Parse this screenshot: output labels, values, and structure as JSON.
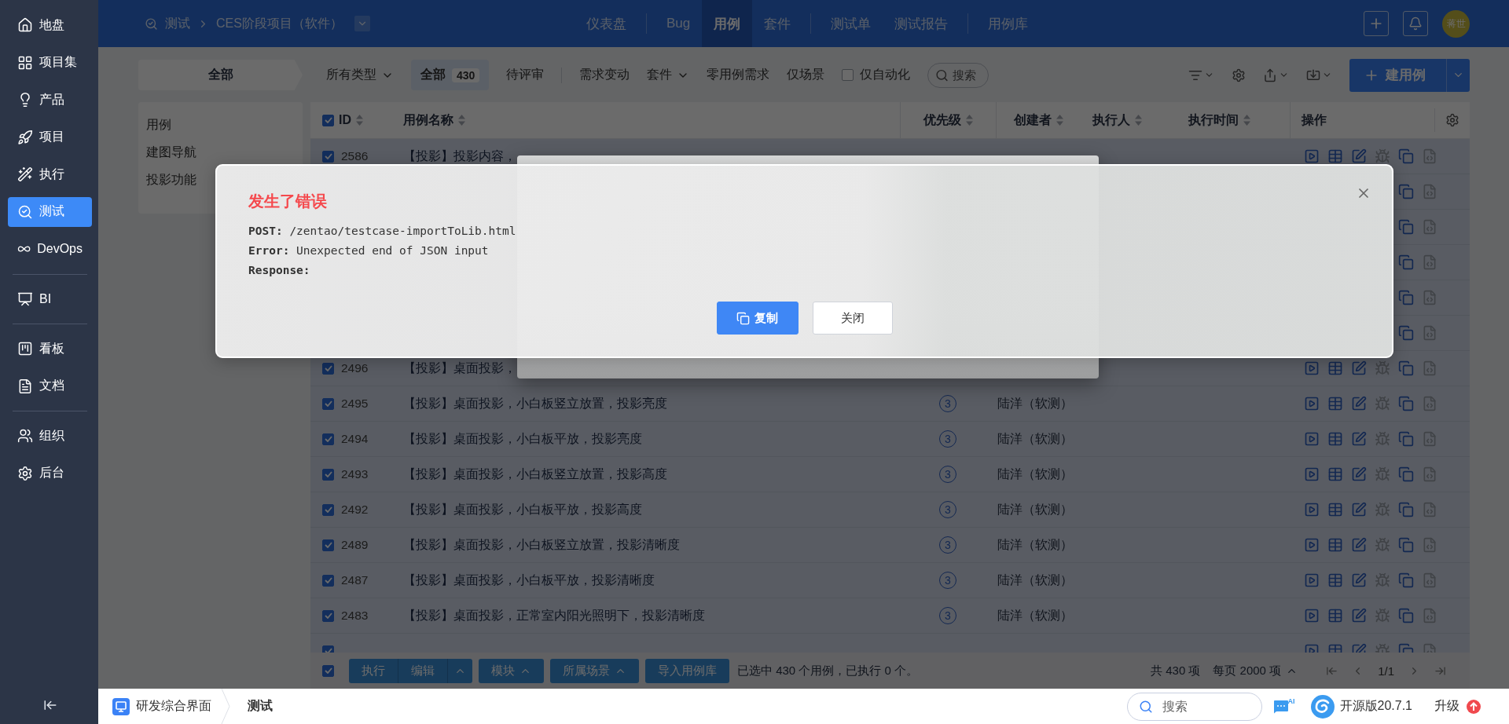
{
  "sidebar": {
    "groups": [
      {
        "items": [
          {
            "label": "地盘",
            "selected": false
          },
          {
            "label": "项目集",
            "selected": false
          },
          {
            "label": "产品",
            "selected": false
          },
          {
            "label": "项目",
            "selected": false
          },
          {
            "label": "执行",
            "selected": false
          },
          {
            "label": "测试",
            "selected": true
          },
          {
            "label": "DevOps",
            "selected": false
          }
        ]
      },
      {
        "items": [
          {
            "label": "BI",
            "selected": false
          }
        ]
      },
      {
        "items": [
          {
            "label": "看板",
            "selected": false
          },
          {
            "label": "文档",
            "selected": false
          }
        ]
      },
      {
        "items": [
          {
            "label": "组织",
            "selected": false
          },
          {
            "label": "后台",
            "selected": false
          }
        ]
      }
    ]
  },
  "topbar": {
    "breadcrumb": [
      "测试",
      "CES阶段项目（软件）"
    ],
    "nav_groups": [
      {
        "items": [
          {
            "label": "仪表盘",
            "selected": false
          }
        ]
      },
      {
        "items": [
          {
            "label": "Bug",
            "selected": false
          },
          {
            "label": "用例",
            "selected": true
          },
          {
            "label": "套件",
            "selected": false
          }
        ]
      },
      {
        "items": [
          {
            "label": "测试单",
            "selected": false
          },
          {
            "label": "测试报告",
            "selected": false
          }
        ]
      },
      {
        "items": [
          {
            "label": "用例库",
            "selected": false
          }
        ]
      }
    ],
    "avatar": "蒋世"
  },
  "toolbar": {
    "module_header": "全部",
    "type_filter": "所有类型",
    "tabs": [
      {
        "label": "全部",
        "count": "430",
        "selected": true
      },
      {
        "label": "待评审",
        "selected": false
      }
    ],
    "filters": [
      {
        "label": "需求变动",
        "kind": "link"
      },
      {
        "label": "套件",
        "kind": "dropdown"
      },
      {
        "label": "零用例需求",
        "kind": "link"
      },
      {
        "label": "仅场景",
        "kind": "link"
      },
      {
        "label": "仅自动化",
        "kind": "checkbox",
        "checked": false
      }
    ],
    "search_placeholder": "搜索",
    "create_button": "建用例"
  },
  "modules": [
    "用例",
    "建图导航",
    "投影功能"
  ],
  "table": {
    "header_checked": true,
    "columns": [
      "ID",
      "用例名称",
      "优先级",
      "创建者",
      "执行人",
      "执行时间",
      "操作"
    ],
    "rows": [
      {
        "kind": "case",
        "checked": true,
        "id": "2586",
        "name": "【投影】投影内容，"
      },
      {
        "kind": "covered"
      },
      {
        "kind": "covered"
      },
      {
        "kind": "covered"
      },
      {
        "kind": "covered"
      },
      {
        "kind": "covered"
      },
      {
        "kind": "case",
        "checked": true,
        "id": "2496",
        "name": "【投影】桌面投影，"
      },
      {
        "kind": "case",
        "checked": true,
        "id": "2495",
        "name": "【投影】桌面投影，小白板竖立放置，投影亮度",
        "priority": "3",
        "creator": "陆洋（软测）"
      },
      {
        "kind": "case",
        "checked": true,
        "id": "2494",
        "name": "【投影】桌面投影，小白板平放，投影亮度",
        "priority": "3",
        "creator": "陆洋（软测）"
      },
      {
        "kind": "case",
        "checked": true,
        "id": "2493",
        "name": "【投影】桌面投影，小白板竖立放置，投影高度",
        "priority": "3",
        "creator": "陆洋（软测）"
      },
      {
        "kind": "case",
        "checked": true,
        "id": "2492",
        "name": "【投影】桌面投影，小白板平放，投影高度",
        "priority": "3",
        "creator": "陆洋（软测）"
      },
      {
        "kind": "case",
        "checked": true,
        "id": "2489",
        "name": "【投影】桌面投影，小白板竖立放置，投影清晰度",
        "priority": "3",
        "creator": "陆洋（软测）"
      },
      {
        "kind": "case",
        "checked": true,
        "id": "2487",
        "name": "【投影】桌面投影，小白板平放，投影清晰度",
        "priority": "3",
        "creator": "陆洋（软测）"
      },
      {
        "kind": "case",
        "checked": true,
        "id": "2483",
        "name": "【投影】桌面投影，正常室内阳光照明下，投影清晰度",
        "priority": "3",
        "creator": "陆洋（软测）"
      },
      {
        "kind": "clipped",
        "checked": true
      }
    ]
  },
  "footer": {
    "checked": true,
    "actions": [
      {
        "label": "执行",
        "kind": "group"
      },
      {
        "label": "编辑",
        "kind": "group-menu"
      },
      {
        "label": "模块",
        "kind": "menu"
      },
      {
        "label": "所属场景",
        "kind": "menu"
      },
      {
        "label": "导入用例库",
        "kind": "plain"
      }
    ],
    "summary": "已选中 430 个用例，已执行 0 个。",
    "total": "共 430 项",
    "page_size": "每页 2000 项",
    "page": "1/1"
  },
  "bottom": {
    "app": "研发综合界面",
    "current": "测试",
    "search_placeholder": "搜索",
    "ai_badge": "AI",
    "edition": "开源版20.7.1",
    "upgrade": "升级"
  },
  "modal": {
    "title": "发生了错误",
    "lines": [
      "**POST:** /zentao/testcase-importToLib.html",
      "**Error:** Unexpected end of JSON input",
      "**Response:**"
    ],
    "buttons": [
      {
        "label": "复制",
        "kind": "primary"
      },
      {
        "label": "关闭",
        "kind": "default"
      }
    ]
  }
}
